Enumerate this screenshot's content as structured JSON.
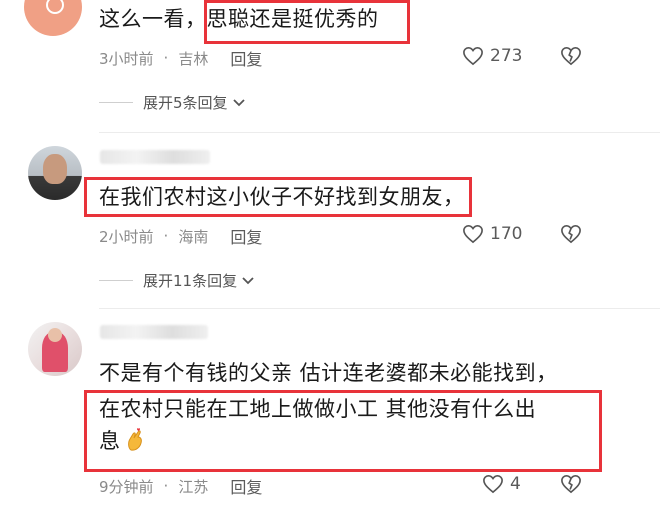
{
  "comments": [
    {
      "text": "这么一看，",
      "highlight": "思聪还是挺优秀的",
      "time": "3小时前",
      "location": "吉林",
      "reply_label": "回复",
      "likes": "273",
      "expand_label": "展开5条回复"
    },
    {
      "highlight": "在我们农村这小伙子不好找到女朋友",
      "suffix": "，",
      "time": "2小时前",
      "location": "海南",
      "reply_label": "回复",
      "likes": "170",
      "expand_label": "展开11条回复"
    },
    {
      "line1": "不是有个有钱的父亲 估计连老婆都未必能找到，",
      "highlight_line1": "在农村只能在工地上做做小工  其他没有什么出",
      "highlight_line2": "息",
      "time": "9分钟前",
      "location": "江苏",
      "reply_label": "回复",
      "likes": "4"
    }
  ],
  "colors": {
    "highlight_border": "#e8333a",
    "meta_text": "#8a8a8a",
    "body_text": "#1a1a1a"
  },
  "icons": {
    "like": "heart-outline-icon",
    "dislike": "broken-heart-icon",
    "expand": "chevron-down-icon",
    "emoji": "finger-heart-emoji"
  }
}
